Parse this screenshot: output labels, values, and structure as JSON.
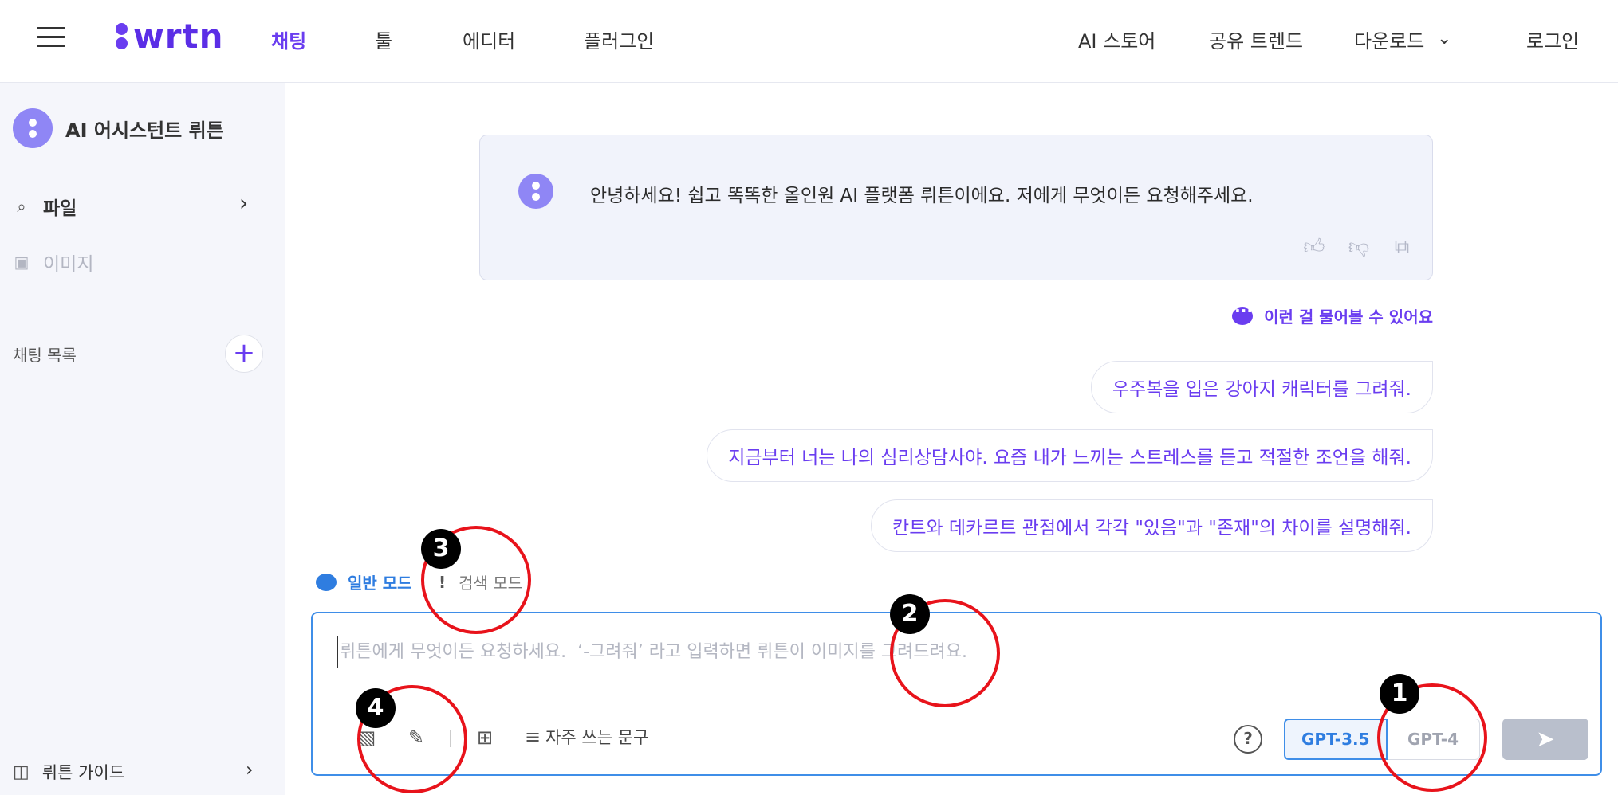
{
  "header": {
    "logo": "wrtn",
    "nav": [
      "채팅",
      "툴",
      "에디터",
      "플러그인"
    ],
    "right_nav": [
      "AI 스토어",
      "공유 트렌드",
      "다운로드",
      "로그인"
    ]
  },
  "sidebar": {
    "assistant_name": "AI 어시스턴트 뤼튼",
    "file_label": "파일",
    "image_label": "이미지",
    "chat_list_label": "채팅 목록",
    "add_label": "+",
    "guide_label": "뤼튼 가이드"
  },
  "chat": {
    "welcome": "안녕하세요! 쉽고 똑똑한 올인원 AI 플랫폼 뤼튼이에요. 저에게 무엇이든 요청해주세요.",
    "suggest_title": "이런 걸 물어볼 수 있어요",
    "suggestions": [
      "우주복을 입은 강아지 캐릭터를 그려줘.",
      "지금부터 너는 나의 심리상담사야. 요즘 내가 느끼는 스트레스를 듣고 적절한 조언을 해줘.",
      "칸트와 데카르트 관점에서 각각 \"있음\"과 \"존재\"의 차이를 설명해줘."
    ]
  },
  "modes": {
    "normal": "일반 모드",
    "search": "검색 모드",
    "search_mark": "!"
  },
  "input": {
    "placeholder": "뤼튼에게 무엇이든 요청하세요.  ‘-그려줘’ 라고 입력하면 뤼튼이 이미지를 그려드려요.",
    "phrases": "자주 쓰는 문구",
    "help": "?",
    "models": [
      "GPT-3.5",
      "GPT-4"
    ],
    "send": "➤"
  },
  "annotations": [
    "1",
    "2",
    "3",
    "4"
  ],
  "colors": {
    "brand": "#5b2ee6",
    "accent_blue": "#2f7de0",
    "annotation_red": "#e8131b"
  }
}
